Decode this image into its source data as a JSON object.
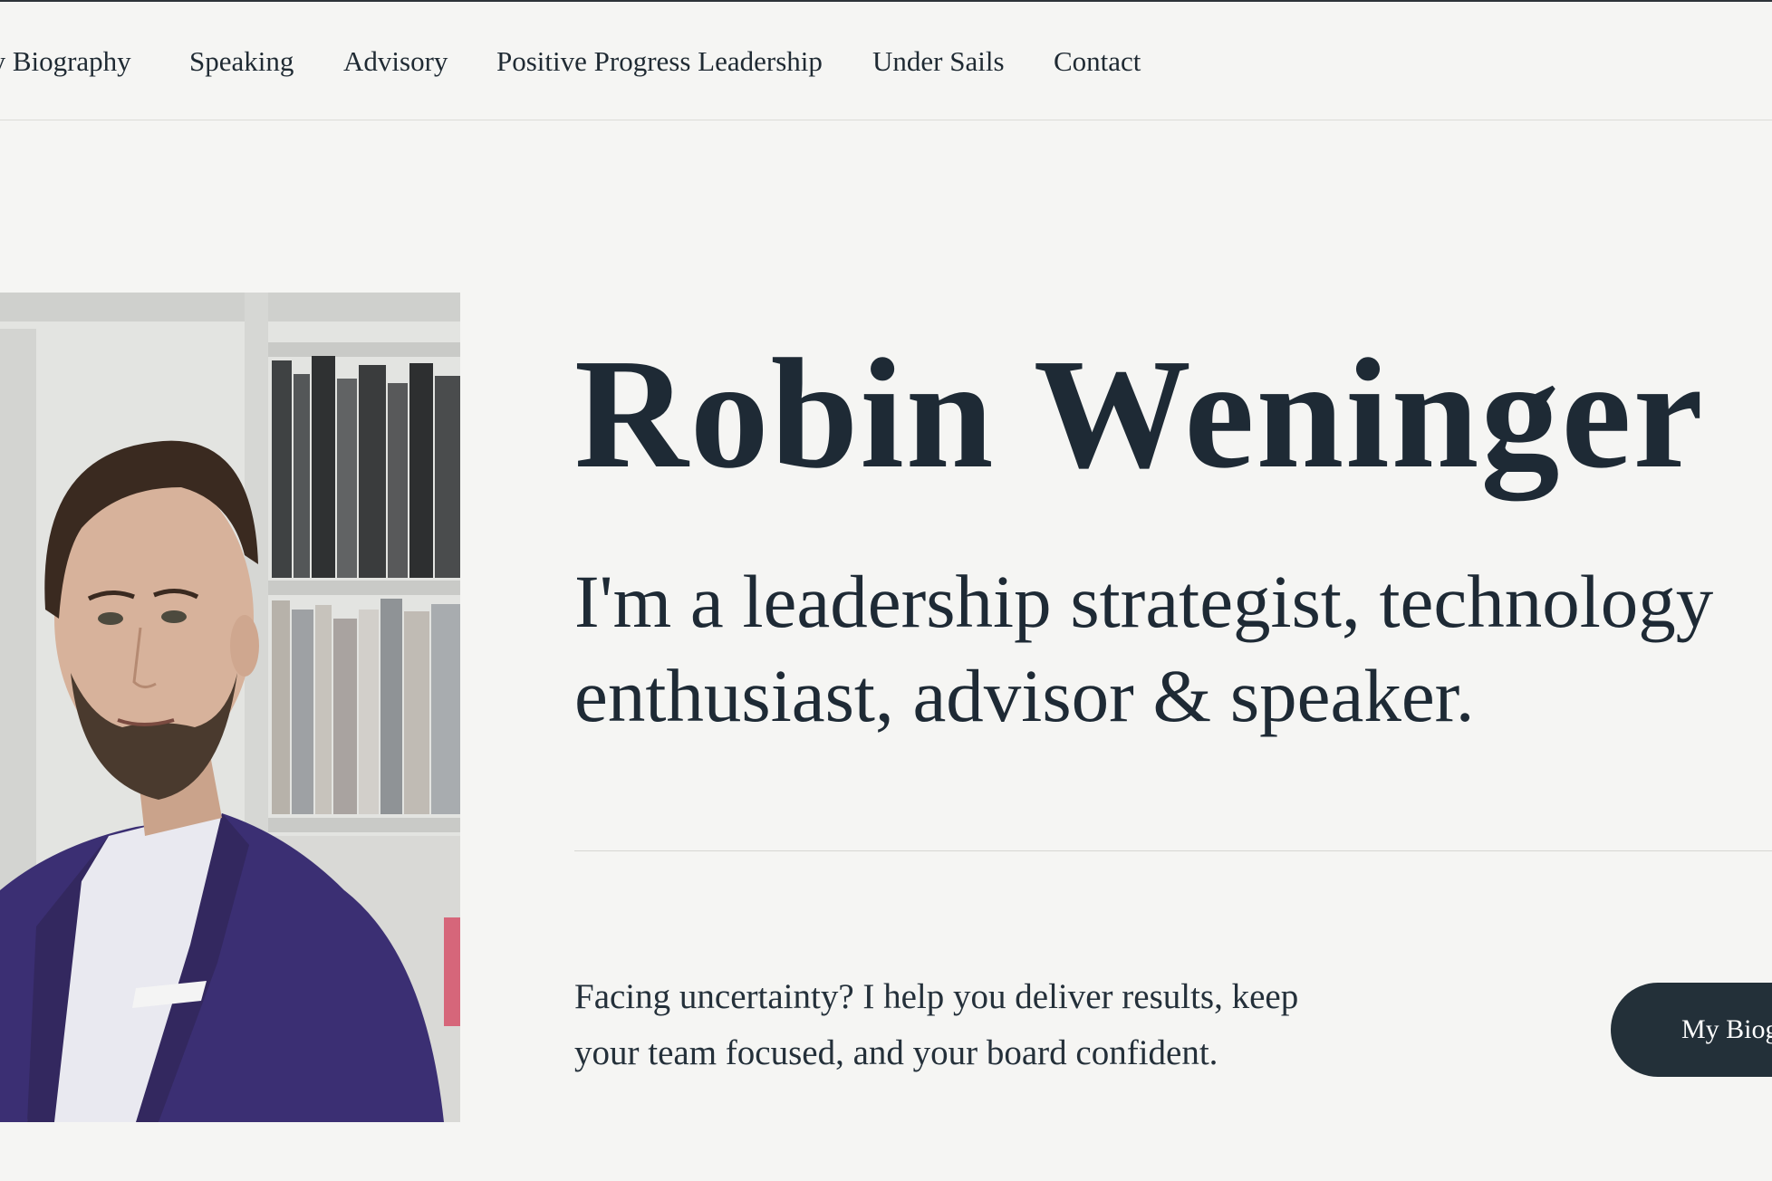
{
  "nav": {
    "items": [
      {
        "label": "My Biography"
      },
      {
        "label": "Speaking"
      },
      {
        "label": "Advisory"
      },
      {
        "label": "Positive Progress Leadership"
      },
      {
        "label": "Under Sails"
      },
      {
        "label": "Contact"
      }
    ]
  },
  "hero": {
    "name": "Robin Weninger",
    "tagline": "I'm a leadership strategist, technology enthusiast, advisor & speaker.",
    "body": "Facing uncertainty? I help you deliver results, keep your team focused, and your board confident.",
    "cta_label": "My Biography"
  },
  "colors": {
    "background": "#f5f5f3",
    "text": "#1e2a35",
    "button": "#233039",
    "suit": "#3b2f73"
  }
}
